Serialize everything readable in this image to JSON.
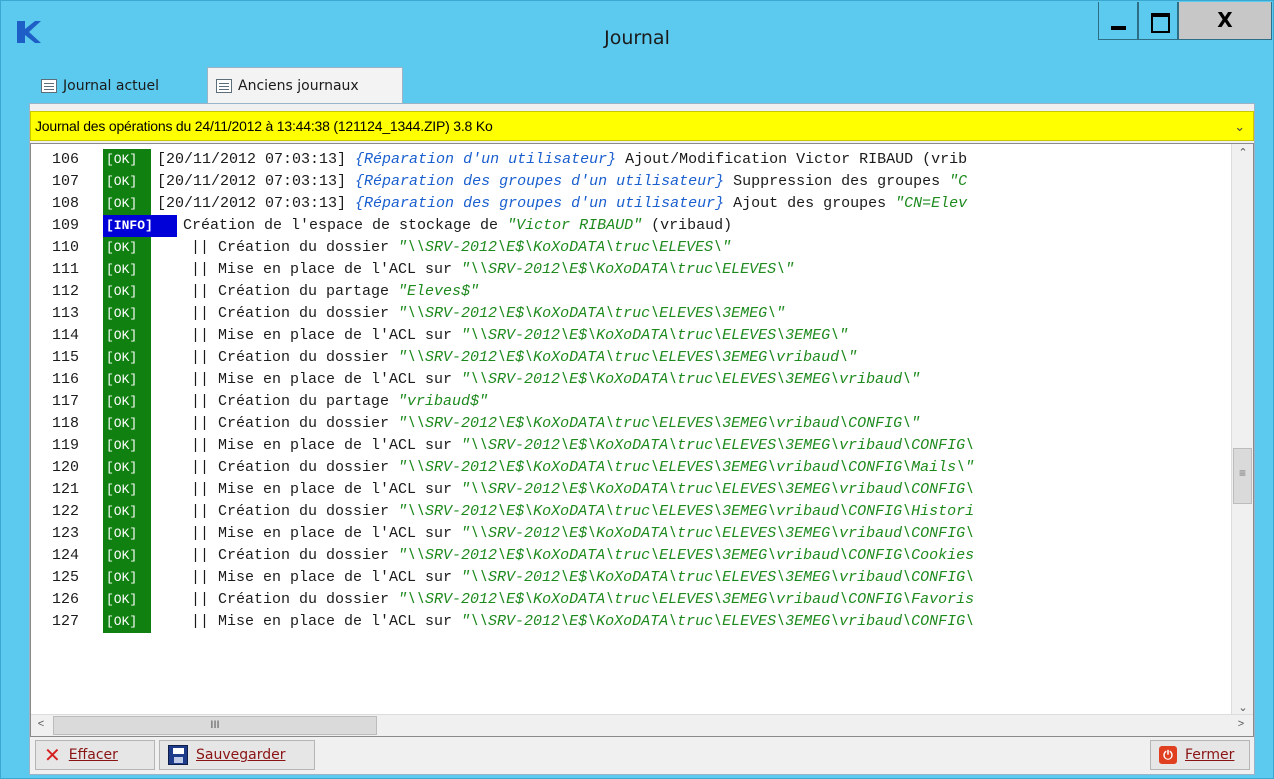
{
  "window": {
    "title": "Journal",
    "close_glyph": "X",
    "colors": {
      "titlebar": "#5cc9ee",
      "combo": "#ffff00",
      "ok_badge": "#108010",
      "info_badge": "#0000d8",
      "path_green": "#1e8a1e",
      "step_blue": "#1a5fcf"
    }
  },
  "tabs": [
    {
      "label": "Journal actuel",
      "icon": "log-page-icon",
      "active": false
    },
    {
      "label": "Anciens journaux",
      "icon": "log-page-icon",
      "active": true
    }
  ],
  "journal_select": {
    "selected": "Journal des opérations du 24/11/2012 à 13:44:38  (121124_1344.ZIP)  3.8 Ko"
  },
  "log": {
    "lines": [
      {
        "num": "106",
        "badge": "[OK]",
        "type": "ok",
        "indent": false,
        "parts": [
          {
            "t": "[20/11/2012 07:03:13] ",
            "s": "c"
          },
          {
            "t": "{Réparation d'un utilisateur}",
            "s": "blue"
          },
          {
            "t": " Ajout/Modification Victor RIBAUD (vrib",
            "s": "c"
          }
        ]
      },
      {
        "num": "107",
        "badge": "[OK]",
        "type": "ok",
        "indent": false,
        "parts": [
          {
            "t": "[20/11/2012 07:03:13] ",
            "s": "c"
          },
          {
            "t": "{Réparation des groupes d'un utilisateur}",
            "s": "blue"
          },
          {
            "t": " Suppression des groupes ",
            "s": "c"
          },
          {
            "t": "\"C",
            "s": "green"
          }
        ]
      },
      {
        "num": "108",
        "badge": "[OK]",
        "type": "ok",
        "indent": false,
        "parts": [
          {
            "t": "[20/11/2012 07:03:13] ",
            "s": "c"
          },
          {
            "t": "{Réparation des groupes d'un utilisateur}",
            "s": "blue"
          },
          {
            "t": " Ajout des groupes ",
            "s": "c"
          },
          {
            "t": "\"CN=Elev",
            "s": "green"
          }
        ]
      },
      {
        "num": "109",
        "badge": "[INFO]",
        "type": "info",
        "indent": false,
        "parts": [
          {
            "t": "Création de l'espace de stockage de ",
            "s": "c"
          },
          {
            "t": "\"Victor RIBAUD\"",
            "s": "green"
          },
          {
            "t": " (vribaud)",
            "s": "c"
          }
        ]
      },
      {
        "num": "110",
        "badge": "[OK]",
        "type": "ok",
        "indent": true,
        "parts": [
          {
            "t": "|| Création du dossier ",
            "s": "c"
          },
          {
            "t": "\"\\\\SRV-2012\\E$\\KoXoDATA\\truc\\ELEVES\\\"",
            "s": "green"
          }
        ]
      },
      {
        "num": "111",
        "badge": "[OK]",
        "type": "ok",
        "indent": true,
        "parts": [
          {
            "t": "|| Mise en place de l'ACL sur ",
            "s": "c"
          },
          {
            "t": "\"\\\\SRV-2012\\E$\\KoXoDATA\\truc\\ELEVES\\\"",
            "s": "green"
          }
        ]
      },
      {
        "num": "112",
        "badge": "[OK]",
        "type": "ok",
        "indent": true,
        "parts": [
          {
            "t": "|| Création du partage ",
            "s": "c"
          },
          {
            "t": "\"Eleves$\"",
            "s": "green"
          }
        ]
      },
      {
        "num": "113",
        "badge": "[OK]",
        "type": "ok",
        "indent": true,
        "parts": [
          {
            "t": "|| Création du dossier ",
            "s": "c"
          },
          {
            "t": "\"\\\\SRV-2012\\E$\\KoXoDATA\\truc\\ELEVES\\3EMEG\\\"",
            "s": "green"
          }
        ]
      },
      {
        "num": "114",
        "badge": "[OK]",
        "type": "ok",
        "indent": true,
        "parts": [
          {
            "t": "|| Mise en place de l'ACL sur ",
            "s": "c"
          },
          {
            "t": "\"\\\\SRV-2012\\E$\\KoXoDATA\\truc\\ELEVES\\3EMEG\\\"",
            "s": "green"
          }
        ]
      },
      {
        "num": "115",
        "badge": "[OK]",
        "type": "ok",
        "indent": true,
        "parts": [
          {
            "t": "|| Création du dossier ",
            "s": "c"
          },
          {
            "t": "\"\\\\SRV-2012\\E$\\KoXoDATA\\truc\\ELEVES\\3EMEG\\vribaud\\\"",
            "s": "green"
          }
        ]
      },
      {
        "num": "116",
        "badge": "[OK]",
        "type": "ok",
        "indent": true,
        "parts": [
          {
            "t": "|| Mise en place de l'ACL sur ",
            "s": "c"
          },
          {
            "t": "\"\\\\SRV-2012\\E$\\KoXoDATA\\truc\\ELEVES\\3EMEG\\vribaud\\\"",
            "s": "green"
          }
        ]
      },
      {
        "num": "117",
        "badge": "[OK]",
        "type": "ok",
        "indent": true,
        "parts": [
          {
            "t": "|| Création du partage ",
            "s": "c"
          },
          {
            "t": "\"vribaud$\"",
            "s": "green"
          }
        ]
      },
      {
        "num": "118",
        "badge": "[OK]",
        "type": "ok",
        "indent": true,
        "parts": [
          {
            "t": "|| Création du dossier ",
            "s": "c"
          },
          {
            "t": "\"\\\\SRV-2012\\E$\\KoXoDATA\\truc\\ELEVES\\3EMEG\\vribaud\\CONFIG\\\"",
            "s": "green"
          }
        ]
      },
      {
        "num": "119",
        "badge": "[OK]",
        "type": "ok",
        "indent": true,
        "parts": [
          {
            "t": "|| Mise en place de l'ACL sur ",
            "s": "c"
          },
          {
            "t": "\"\\\\SRV-2012\\E$\\KoXoDATA\\truc\\ELEVES\\3EMEG\\vribaud\\CONFIG\\",
            "s": "green"
          }
        ]
      },
      {
        "num": "120",
        "badge": "[OK]",
        "type": "ok",
        "indent": true,
        "parts": [
          {
            "t": "|| Création du dossier ",
            "s": "c"
          },
          {
            "t": "\"\\\\SRV-2012\\E$\\KoXoDATA\\truc\\ELEVES\\3EMEG\\vribaud\\CONFIG\\Mails\\\"",
            "s": "green"
          }
        ]
      },
      {
        "num": "121",
        "badge": "[OK]",
        "type": "ok",
        "indent": true,
        "parts": [
          {
            "t": "|| Mise en place de l'ACL sur ",
            "s": "c"
          },
          {
            "t": "\"\\\\SRV-2012\\E$\\KoXoDATA\\truc\\ELEVES\\3EMEG\\vribaud\\CONFIG\\",
            "s": "green"
          }
        ]
      },
      {
        "num": "122",
        "badge": "[OK]",
        "type": "ok",
        "indent": true,
        "parts": [
          {
            "t": "|| Création du dossier ",
            "s": "c"
          },
          {
            "t": "\"\\\\SRV-2012\\E$\\KoXoDATA\\truc\\ELEVES\\3EMEG\\vribaud\\CONFIG\\Histori",
            "s": "green"
          }
        ]
      },
      {
        "num": "123",
        "badge": "[OK]",
        "type": "ok",
        "indent": true,
        "parts": [
          {
            "t": "|| Mise en place de l'ACL sur ",
            "s": "c"
          },
          {
            "t": "\"\\\\SRV-2012\\E$\\KoXoDATA\\truc\\ELEVES\\3EMEG\\vribaud\\CONFIG\\",
            "s": "green"
          }
        ]
      },
      {
        "num": "124",
        "badge": "[OK]",
        "type": "ok",
        "indent": true,
        "parts": [
          {
            "t": "|| Création du dossier ",
            "s": "c"
          },
          {
            "t": "\"\\\\SRV-2012\\E$\\KoXoDATA\\truc\\ELEVES\\3EMEG\\vribaud\\CONFIG\\Cookies",
            "s": "green"
          }
        ]
      },
      {
        "num": "125",
        "badge": "[OK]",
        "type": "ok",
        "indent": true,
        "parts": [
          {
            "t": "|| Mise en place de l'ACL sur ",
            "s": "c"
          },
          {
            "t": "\"\\\\SRV-2012\\E$\\KoXoDATA\\truc\\ELEVES\\3EMEG\\vribaud\\CONFIG\\",
            "s": "green"
          }
        ]
      },
      {
        "num": "126",
        "badge": "[OK]",
        "type": "ok",
        "indent": true,
        "parts": [
          {
            "t": "|| Création du dossier ",
            "s": "c"
          },
          {
            "t": "\"\\\\SRV-2012\\E$\\KoXoDATA\\truc\\ELEVES\\3EMEG\\vribaud\\CONFIG\\Favoris",
            "s": "green"
          }
        ]
      },
      {
        "num": "127",
        "badge": "[OK]",
        "type": "ok",
        "indent": true,
        "parts": [
          {
            "t": "|| Mise en place de l'ACL sur ",
            "s": "c"
          },
          {
            "t": "\"\\\\SRV-2012\\E$\\KoXoDATA\\truc\\ELEVES\\3EMEG\\vribaud\\CONFIG\\",
            "s": "green"
          }
        ]
      }
    ]
  },
  "scrollbars": {
    "vertical_grip": "≡",
    "horizontal_grip": "III"
  },
  "buttons": {
    "effacer": "Effacer",
    "sauvegarder": "Sauvegarder",
    "fermer": "Fermer"
  }
}
